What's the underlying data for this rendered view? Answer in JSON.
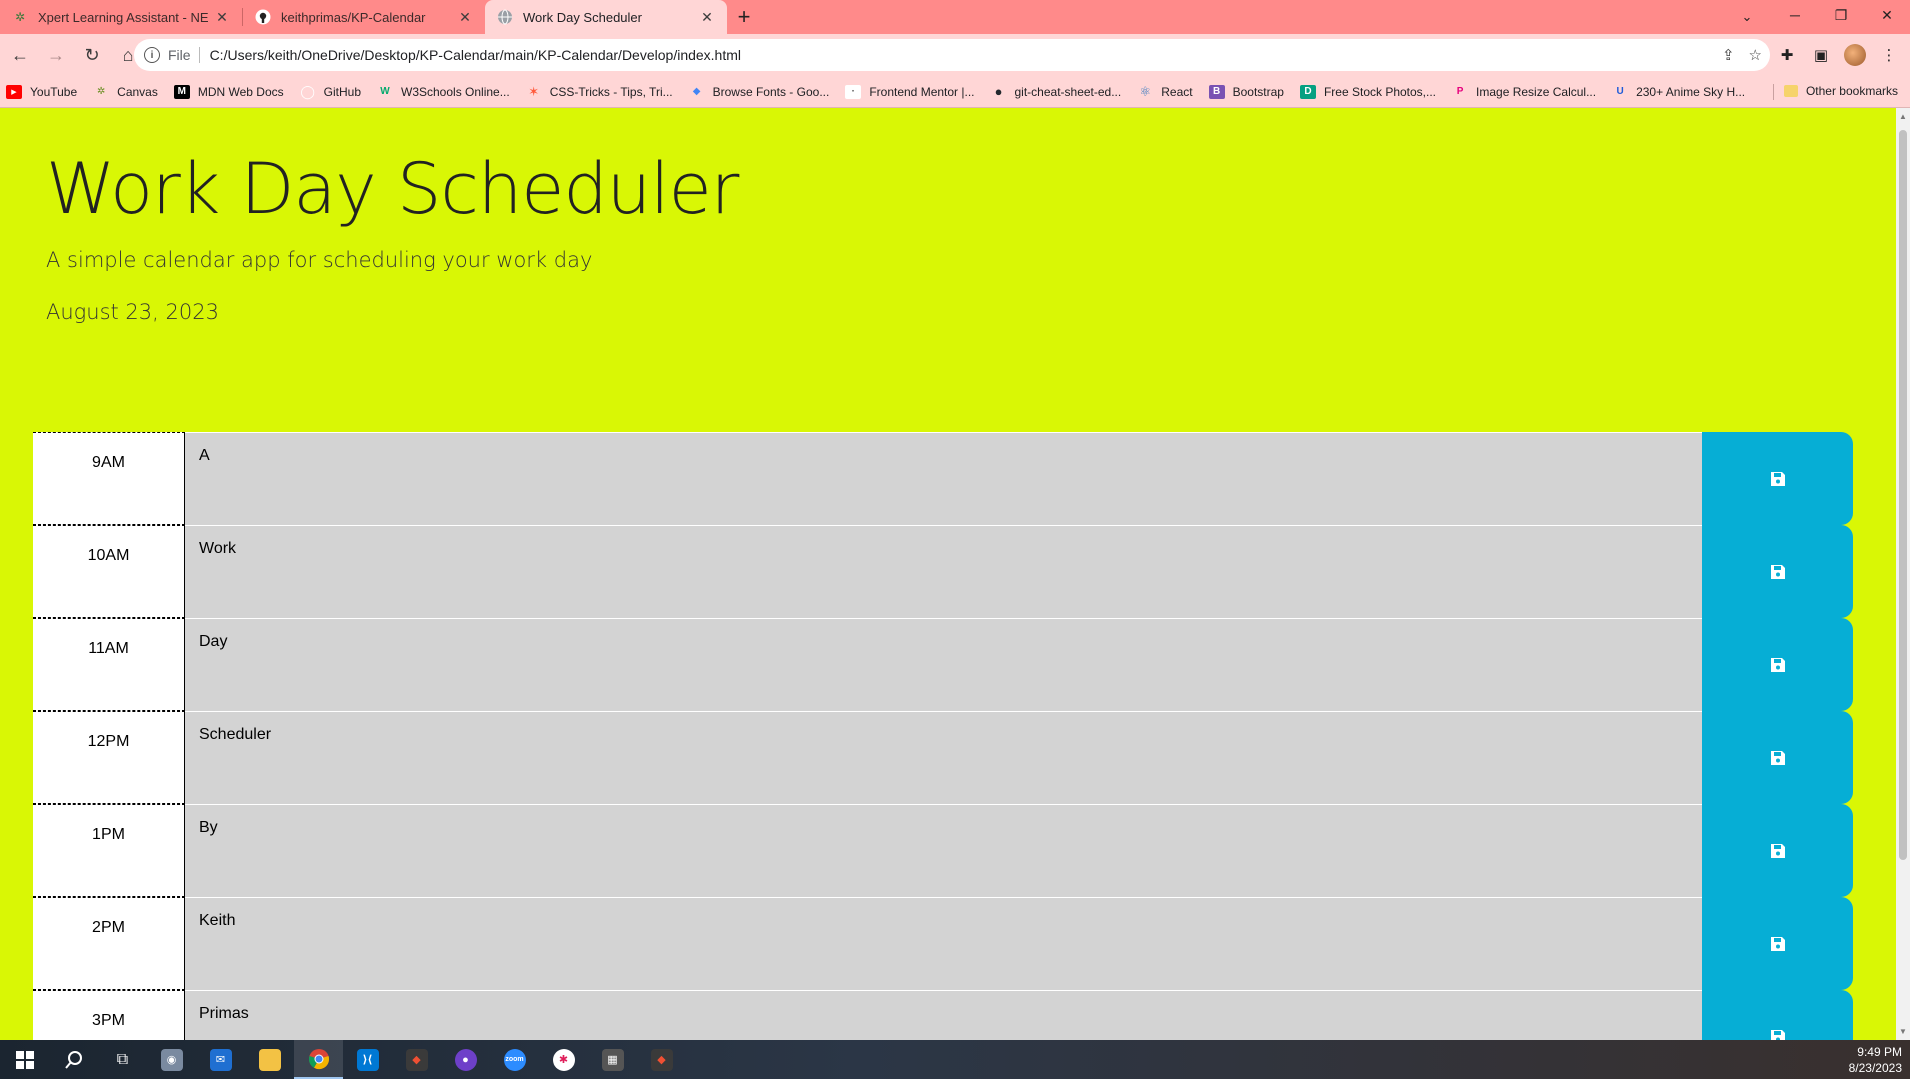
{
  "browser": {
    "tabs": [
      {
        "title": "Xpert Learning Assistant - NEW!",
        "favicon": "edx-icon",
        "active": false
      },
      {
        "title": "keithprimas/KP-Calendar",
        "favicon": "github-icon",
        "active": false
      },
      {
        "title": "Work Day Scheduler",
        "favicon": "globe-icon",
        "active": true
      }
    ],
    "new_tab_label": "+",
    "address": {
      "scheme": "File",
      "url": "C:/Users/keith/OneDrive/Desktop/KP-Calendar/main/KP-Calendar/Develop/index.html"
    },
    "bookmarks": [
      {
        "label": "YouTube",
        "icon": "youtube-icon",
        "color": "#ff0000",
        "glyph": "▶"
      },
      {
        "label": "Canvas",
        "icon": "canvas-icon",
        "color": "#6b8e23",
        "glyph": "✲"
      },
      {
        "label": "MDN Web Docs",
        "icon": "mdn-icon",
        "color": "#000000",
        "glyph": "M"
      },
      {
        "label": "GitHub",
        "icon": "github-icon",
        "color": "#ffffff",
        "glyph": "◯"
      },
      {
        "label": "W3Schools Online...",
        "icon": "w3schools-icon",
        "color": "#04aa6d",
        "glyph": "W"
      },
      {
        "label": "CSS-Tricks - Tips, Tri...",
        "icon": "css-tricks-icon",
        "color": "#ff5a3c",
        "glyph": "✶"
      },
      {
        "label": "Browse Fonts - Goo...",
        "icon": "google-fonts-icon",
        "color": "#4285f4",
        "glyph": "◆"
      },
      {
        "label": "Frontend Mentor |...",
        "icon": "frontend-mentor-icon",
        "color": "#ffffff",
        "glyph": "·"
      },
      {
        "label": "git-cheat-sheet-ed...",
        "icon": "github-icon",
        "color": "#24292e",
        "glyph": "●"
      },
      {
        "label": "React",
        "icon": "react-icon",
        "color": "#61dafb",
        "glyph": "⚛"
      },
      {
        "label": "Bootstrap",
        "icon": "bootstrap-icon",
        "color": "#7952b3",
        "glyph": "B"
      },
      {
        "label": "Free Stock Photos,...",
        "icon": "stock-photos-icon",
        "color": "#05a081",
        "glyph": "D"
      },
      {
        "label": "Image Resize Calcul...",
        "icon": "image-resize-icon",
        "color": "#e6007e",
        "glyph": "P"
      },
      {
        "label": "230+ Anime Sky H...",
        "icon": "anime-sky-icon",
        "color": "#1e5bd8",
        "glyph": "U"
      }
    ],
    "other_bookmarks_label": "Other bookmarks"
  },
  "page": {
    "title": "Work Day Scheduler",
    "lead": "A simple calendar app for scheduling your work day",
    "current_date": "August 23, 2023",
    "colors": {
      "background": "#d9f705",
      "past": "#d3d3d3",
      "save": "#06aed5"
    },
    "time_blocks": [
      {
        "hour": "9AM",
        "text": "A"
      },
      {
        "hour": "10AM",
        "text": "Work"
      },
      {
        "hour": "11AM",
        "text": "Day"
      },
      {
        "hour": "12PM",
        "text": "Scheduler"
      },
      {
        "hour": "1PM",
        "text": "By"
      },
      {
        "hour": "2PM",
        "text": "Keith"
      },
      {
        "hour": "3PM",
        "text": "Primas"
      }
    ],
    "save_icon": "floppy-disk-icon"
  },
  "taskbar": {
    "apps": [
      "windows-start-icon",
      "search-icon",
      "task-view-icon",
      "camera-icon",
      "mail-icon",
      "file-explorer-icon",
      "chrome-icon",
      "vscode-icon",
      "git-gui-icon",
      "github-desktop-icon",
      "zoom-icon",
      "slack-icon",
      "calculator-icon",
      "git-gui-icon"
    ],
    "time": "9:49 PM",
    "date": "8/23/2023"
  }
}
